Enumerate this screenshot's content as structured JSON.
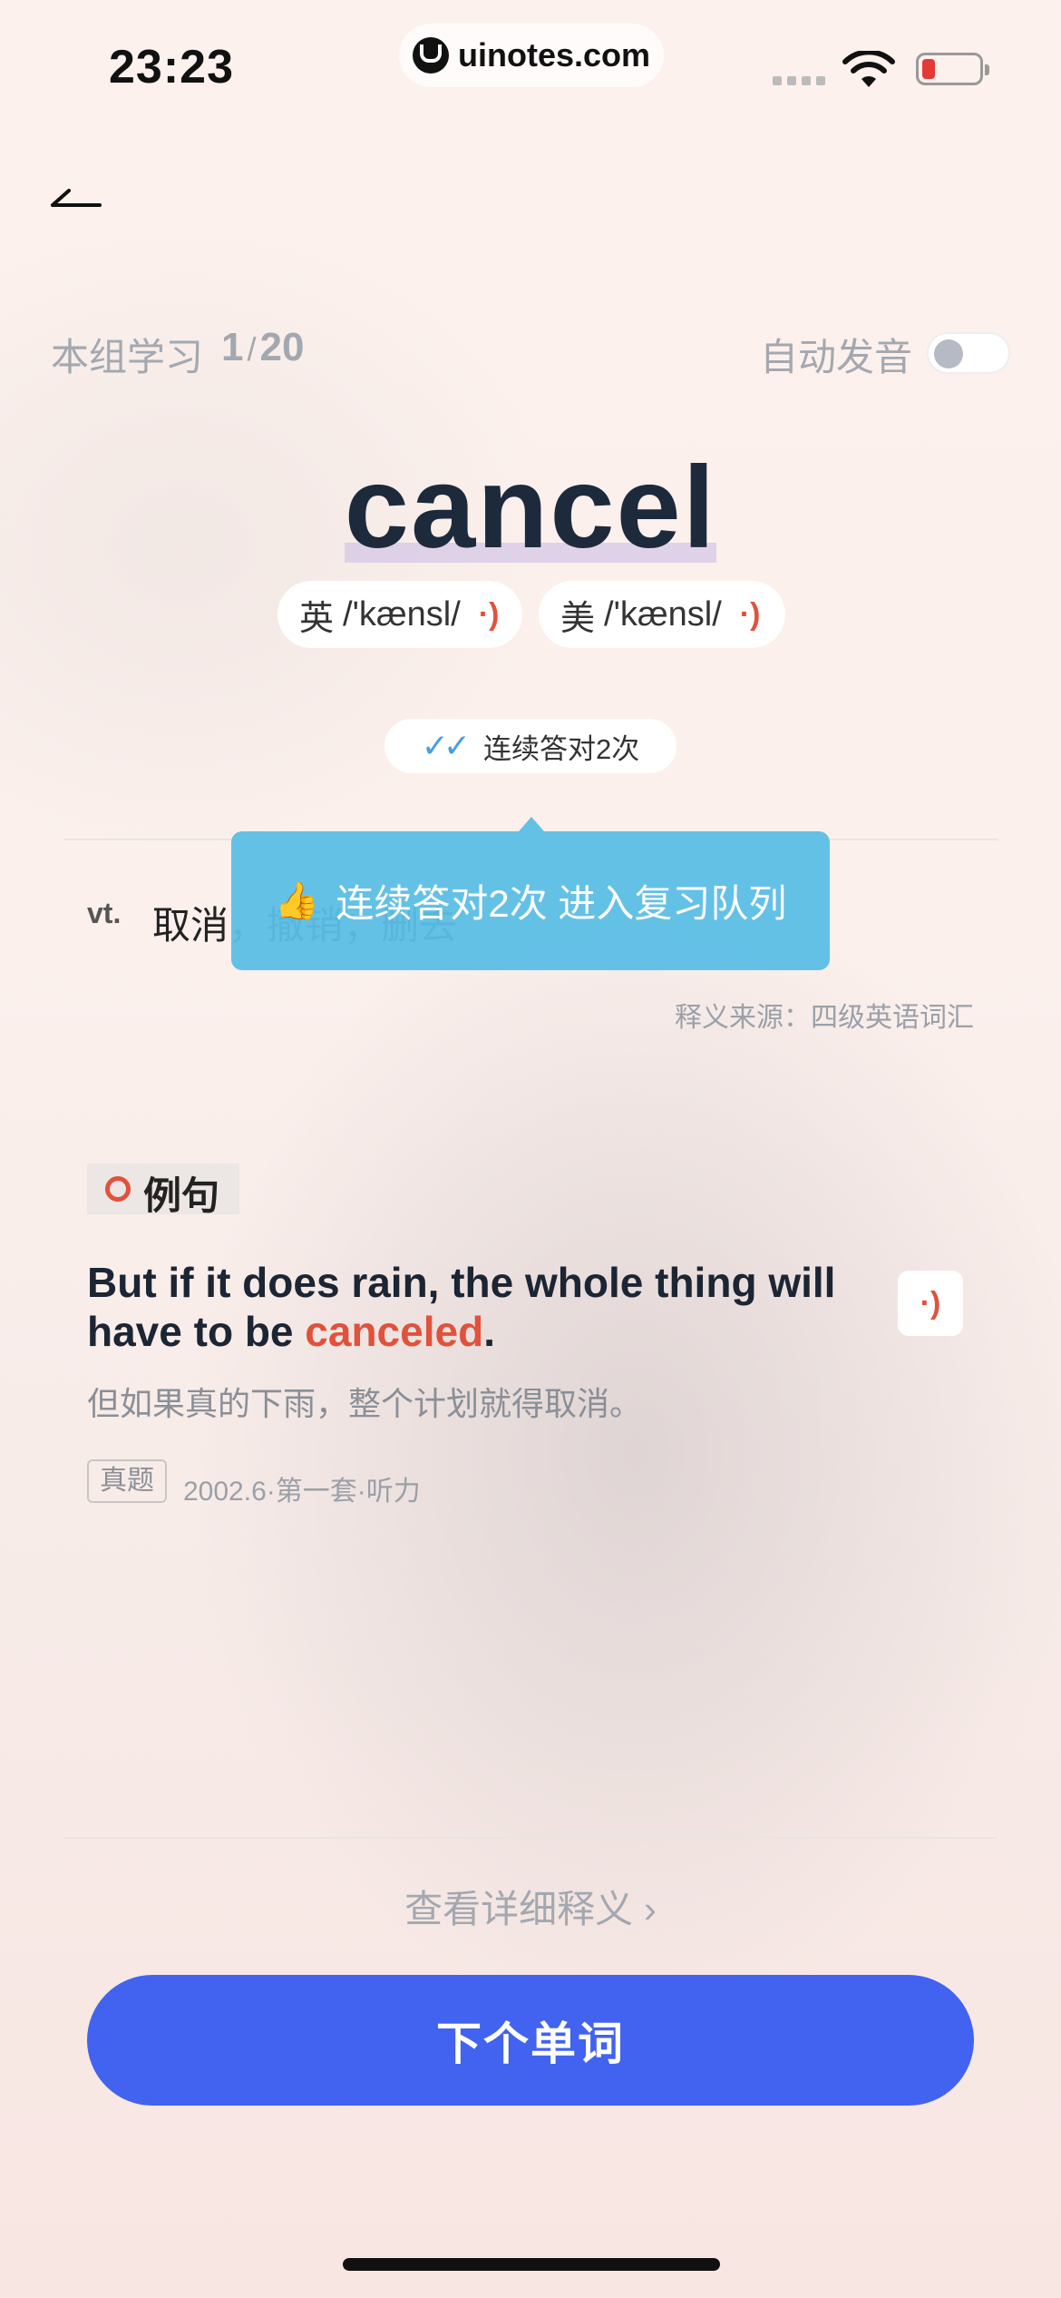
{
  "status_bar": {
    "time": "23:23",
    "url": "uinotes.com"
  },
  "progress": {
    "label": "本组学习",
    "current": "1",
    "separator": "/",
    "total": "20"
  },
  "auto_pronounce": {
    "label": "自动发音",
    "enabled": false
  },
  "word": {
    "text": "cancel",
    "uk": {
      "label": "英",
      "phonetic": "/'kænsl/"
    },
    "us": {
      "label": "美",
      "phonetic": "/'kænsl/"
    }
  },
  "streak_badge": {
    "text": "连续答对2次"
  },
  "tooltip": {
    "text": "连续答对2次 进入复习队列"
  },
  "definition": {
    "pos": "vt.",
    "meaning": "取消，撤销；删去",
    "source": "释义来源：四级英语词汇"
  },
  "example": {
    "section_title": "例句",
    "en_before": "But if it does rain, the whole thing will have to be ",
    "en_keyword": "canceled",
    "en_after": ".",
    "cn": "但如果真的下雨，整个计划就得取消。",
    "tag": "真题",
    "exam_source": "2002.6·第一套·听力"
  },
  "details_link": "查看详细释义 ›",
  "next_button": "下个单词",
  "colors": {
    "accent_red": "#e0523b",
    "primary_blue": "#4262f0",
    "tooltip_blue": "#5cbee6"
  }
}
